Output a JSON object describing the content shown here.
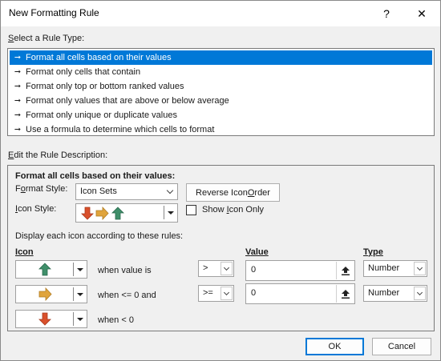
{
  "window": {
    "title": "New Formatting Rule",
    "help_glyph": "?",
    "close_glyph": "✕"
  },
  "rule_type": {
    "label_accel": "S",
    "label_rest": "elect a Rule Type:",
    "items": [
      {
        "label": "Format all cells based on their values",
        "selected": true
      },
      {
        "label": "Format only cells that contain",
        "selected": false
      },
      {
        "label": "Format only top or bottom ranked values",
        "selected": false
      },
      {
        "label": "Format only values that are above or below average",
        "selected": false
      },
      {
        "label": "Format only unique or duplicate values",
        "selected": false
      },
      {
        "label": "Use a formula to determine which cells to format",
        "selected": false
      }
    ]
  },
  "description": {
    "label_accel": "E",
    "label_rest": "dit the Rule Description:",
    "heading": "Format all cells based on their values:",
    "format_style": {
      "label_pre": "F",
      "label_accel": "o",
      "label_post": "rmat Style:",
      "value": "Icon Sets"
    },
    "reverse_button": {
      "pre": "Reverse Icon ",
      "accel": "O",
      "post": "rder"
    },
    "icon_style": {
      "label_pre": "",
      "label_accel": "I",
      "label_post": "con Style:"
    },
    "show_icon_only": {
      "pre": "Show ",
      "accel": "I",
      "post": "con Only",
      "checked": false
    },
    "rules_intro": "Display each icon according to these rules:",
    "col_icon": {
      "accel": "I",
      "rest": "con"
    },
    "col_value": {
      "accel": "V",
      "rest": "alue"
    },
    "col_type": {
      "accel": "T",
      "rest": "ype"
    },
    "rows": [
      {
        "icon": "green-up-arrow-icon",
        "condition": "when value is",
        "operator": ">",
        "value": "0",
        "type": "Number"
      },
      {
        "icon": "yellow-right-arrow-icon",
        "condition": "when <= 0 and",
        "operator": ">=",
        "value": "0",
        "type": "Number"
      },
      {
        "icon": "red-down-arrow-icon",
        "condition": "when < 0"
      }
    ]
  },
  "buttons": {
    "ok": "OK",
    "cancel": "Cancel"
  },
  "colors": {
    "selection": "#0078d7",
    "arrow_green": "#3f8f6a",
    "arrow_yellow": "#e0a43c",
    "arrow_red": "#d9502b"
  }
}
